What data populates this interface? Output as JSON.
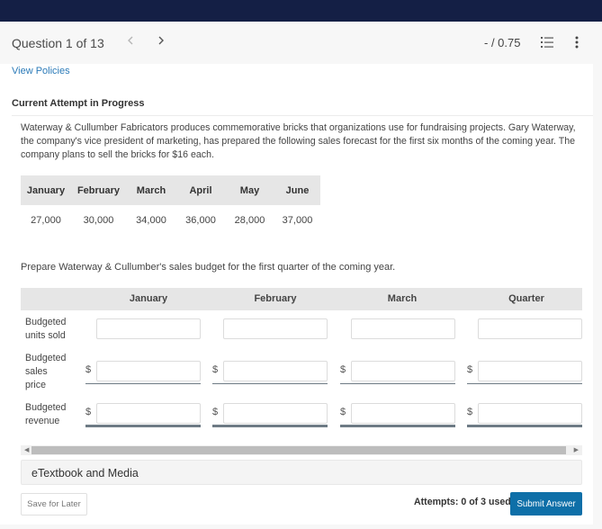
{
  "header": {
    "question_label": "Question 1 of 13",
    "prev_icon": "chevron-left-icon",
    "next_icon": "chevron-right-icon",
    "score": "- / 0.75",
    "list_icon": "list-icon",
    "more_icon": "more-vertical-icon"
  },
  "links": {
    "view_policies": "View Policies"
  },
  "attempt": {
    "title": "Current Attempt in Progress"
  },
  "question": {
    "intro": "Waterway & Cullumber Fabricators produces commemorative bricks that organizations use for fundraising projects. Gary Waterway, the company's vice president of marketing, has prepared the following sales forecast for the first six months of the coming year. The company plans to sell the bricks for $16 each.",
    "forecast": {
      "months": [
        "January",
        "February",
        "March",
        "April",
        "May",
        "June"
      ],
      "units": [
        "27,000",
        "30,000",
        "34,000",
        "36,000",
        "28,000",
        "37,000"
      ]
    },
    "prompt": "Prepare Waterway & Cullumber's sales budget for the first quarter of the coming year."
  },
  "budget": {
    "columns": [
      "January",
      "February",
      "March",
      "Quarter"
    ],
    "rows": [
      {
        "label": "Budgeted units sold",
        "prefix": "",
        "values": [
          "",
          "",
          "",
          ""
        ]
      },
      {
        "label": "Budgeted sales price",
        "prefix": "$",
        "values": [
          "",
          "",
          "",
          ""
        ]
      },
      {
        "label": "Budgeted revenue",
        "prefix": "$",
        "values": [
          "",
          "",
          "",
          ""
        ]
      }
    ]
  },
  "scrollbar": {
    "left_icon": "scroll-left-arrow-icon",
    "right_icon": "scroll-right-arrow-icon"
  },
  "etextbook": {
    "label": "eTextbook and Media"
  },
  "footer": {
    "save_label": "Save for Later",
    "attempts_text": "Attempts: 0 of 3 used",
    "submit_label": "Submit Answer"
  },
  "colors": {
    "topbar": "#141f45",
    "link": "#2a7ab8",
    "submit": "#0e6fa8"
  }
}
